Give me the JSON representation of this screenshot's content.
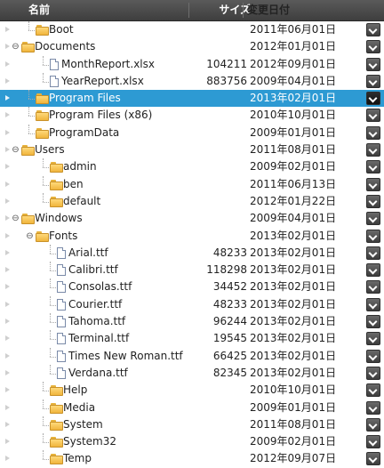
{
  "header": {
    "name": "名前",
    "size": "サイズ",
    "date": "変更日付"
  },
  "rows": [
    {
      "name": "Boot",
      "size": "",
      "date": "2011年06月01日",
      "type": "folder",
      "level": 1,
      "expander": "none",
      "selected": false
    },
    {
      "name": "Documents",
      "size": "",
      "date": "2012年01月01日",
      "type": "folder",
      "level": 0,
      "expander": "collapse",
      "selected": false
    },
    {
      "name": "MonthReport.xlsx",
      "size": "104211",
      "date": "2012年09月01日",
      "type": "file",
      "level": 2,
      "expander": "none",
      "selected": false
    },
    {
      "name": "YearReport.xlsx",
      "size": "883756",
      "date": "2009年04月01日",
      "type": "file",
      "level": 2,
      "expander": "none",
      "selected": false
    },
    {
      "name": "Program Files",
      "size": "",
      "date": "2013年02月01日",
      "type": "folder",
      "level": 1,
      "expander": "none",
      "selected": true
    },
    {
      "name": "Program Files (x86)",
      "size": "",
      "date": "2010年10月01日",
      "type": "folder",
      "level": 1,
      "expander": "none",
      "selected": false
    },
    {
      "name": "ProgramData",
      "size": "",
      "date": "2009年01月01日",
      "type": "folder",
      "level": 1,
      "expander": "none",
      "selected": false
    },
    {
      "name": "Users",
      "size": "",
      "date": "2011年08月01日",
      "type": "folder",
      "level": 0,
      "expander": "collapse",
      "selected": false
    },
    {
      "name": "admin",
      "size": "",
      "date": "2009年02月01日",
      "type": "folder",
      "level": 2,
      "expander": "none",
      "selected": false
    },
    {
      "name": "ben",
      "size": "",
      "date": "2011年06月13日",
      "type": "folder",
      "level": 2,
      "expander": "none",
      "selected": false
    },
    {
      "name": "default",
      "size": "",
      "date": "2012年01月22日",
      "type": "folder",
      "level": 2,
      "expander": "none",
      "selected": false
    },
    {
      "name": "Windows",
      "size": "",
      "date": "2009年04月01日",
      "type": "folder",
      "level": 0,
      "expander": "collapse",
      "selected": false
    },
    {
      "name": "Fonts",
      "size": "",
      "date": "2013年02月01日",
      "type": "folder",
      "level": 1,
      "expander": "collapse",
      "selected": false
    },
    {
      "name": "Arial.ttf",
      "size": "48233",
      "date": "2013年02月01日",
      "type": "file",
      "level": 3,
      "expander": "none",
      "selected": false
    },
    {
      "name": "Calibri.ttf",
      "size": "118298",
      "date": "2013年02月01日",
      "type": "file",
      "level": 3,
      "expander": "none",
      "selected": false
    },
    {
      "name": "Consolas.ttf",
      "size": "34452",
      "date": "2013年02月01日",
      "type": "file",
      "level": 3,
      "expander": "none",
      "selected": false
    },
    {
      "name": "Courier.ttf",
      "size": "48233",
      "date": "2013年02月01日",
      "type": "file",
      "level": 3,
      "expander": "none",
      "selected": false
    },
    {
      "name": "Tahoma.ttf",
      "size": "96244",
      "date": "2013年02月01日",
      "type": "file",
      "level": 3,
      "expander": "none",
      "selected": false
    },
    {
      "name": "Terminal.ttf",
      "size": "19545",
      "date": "2013年02月01日",
      "type": "file",
      "level": 3,
      "expander": "none",
      "selected": false
    },
    {
      "name": "Times New Roman.ttf",
      "size": "66425",
      "date": "2013年02月01日",
      "type": "file",
      "level": 3,
      "expander": "none",
      "selected": false
    },
    {
      "name": "Verdana.ttf",
      "size": "82345",
      "date": "2013年02月01日",
      "type": "file",
      "level": 3,
      "expander": "none",
      "selected": false
    },
    {
      "name": "Help",
      "size": "",
      "date": "2010年10月01日",
      "type": "folder",
      "level": 2,
      "expander": "none",
      "selected": false
    },
    {
      "name": "Media",
      "size": "",
      "date": "2009年01月01日",
      "type": "folder",
      "level": 2,
      "expander": "none",
      "selected": false
    },
    {
      "name": "System",
      "size": "",
      "date": "2011年08月01日",
      "type": "folder",
      "level": 2,
      "expander": "none",
      "selected": false
    },
    {
      "name": "System32",
      "size": "",
      "date": "2009年02月01日",
      "type": "folder",
      "level": 2,
      "expander": "none",
      "selected": false
    },
    {
      "name": "Temp",
      "size": "",
      "date": "2012年09月07日",
      "type": "folder",
      "level": 2,
      "expander": "none",
      "selected": false
    }
  ]
}
